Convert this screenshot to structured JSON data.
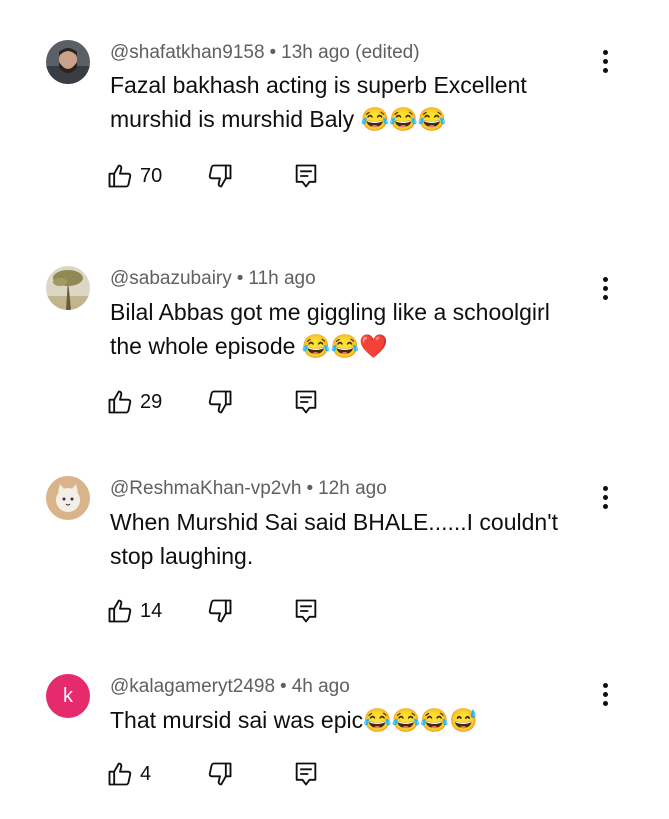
{
  "comments": [
    {
      "handle": "@shafatkhan9158",
      "time": "13h ago (edited)",
      "text_lines": [
        "Fazal  bakhash acting is superb Excellent",
        "murshid is murshid Baly 😂😂😂"
      ],
      "likes": "70",
      "avatar": "photo-man-icon"
    },
    {
      "handle": "@sabazubairy",
      "time": "11h ago",
      "text_lines": [
        "Bilal Abbas got me giggling like a schoolgirl",
        "the whole episode 😂😂❤️"
      ],
      "likes": "29",
      "avatar": "photo-tree-icon"
    },
    {
      "handle": "@ReshmaKhan-vp2vh",
      "time": "12h ago",
      "text_lines": [
        "When Murshid Sai said BHALE......I couldn't",
        "stop laughing."
      ],
      "likes": "14",
      "avatar": "cat-avatar-icon"
    },
    {
      "handle": "@kalagameryt2498",
      "time": "4h ago",
      "text_lines": [
        "That mursid sai was epic😂😂😂😅"
      ],
      "likes": "4",
      "avatar_letter": "k",
      "avatar_color": "#e52b6b"
    }
  ],
  "icons": {
    "like": "thumbs-up-icon",
    "dislike": "thumbs-down-icon",
    "reply": "reply-icon",
    "more": "more-vertical-icon"
  }
}
